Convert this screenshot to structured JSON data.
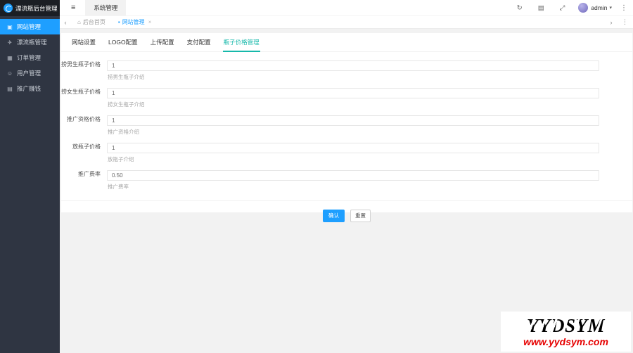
{
  "app": {
    "title": "漂流瓶后台管理"
  },
  "header": {
    "icons": {
      "hamburger": "≡",
      "refresh": "↻",
      "messages": "▤",
      "fullscreen": "⤢",
      "caret": "▾",
      "more": "⋮"
    },
    "nav": [
      {
        "label": "系统管理"
      }
    ],
    "user": "admin"
  },
  "tabbar": {
    "prev": "‹",
    "next": "›",
    "more": "⋮",
    "tabs": [
      {
        "icon": "⌂",
        "label": "后台首页"
      },
      {
        "icon": "▪",
        "label": "网站管理",
        "close": "×"
      }
    ]
  },
  "sidebar": {
    "items": [
      {
        "icon": "▣",
        "label": "网站管理"
      },
      {
        "icon": "✈",
        "label": "漂流瓶管理"
      },
      {
        "icon": "▦",
        "label": "订单管理"
      },
      {
        "icon": "☺",
        "label": "用户管理"
      },
      {
        "icon": "▤",
        "label": "推广赚钱"
      }
    ]
  },
  "main": {
    "tabs": [
      {
        "label": "网站设置"
      },
      {
        "label": "LOGO配置"
      },
      {
        "label": "上传配置"
      },
      {
        "label": "支付配置"
      },
      {
        "label": "瓶子价格管理"
      }
    ],
    "form": {
      "fields": [
        {
          "label": "捞男生瓶子价格",
          "value": "1",
          "help": "捞男生瓶子介绍"
        },
        {
          "label": "捞女生瓶子价格",
          "value": "1",
          "help": "捞女生瓶子介绍"
        },
        {
          "label": "推广资格价格",
          "value": "1",
          "help": "推广资格介绍"
        },
        {
          "label": "放瓶子价格",
          "value": "1",
          "help": "放瓶子介绍"
        },
        {
          "label": "推广费率",
          "value": "0.50",
          "help": "推广费率"
        }
      ],
      "buttons": {
        "confirm": "确认",
        "reset": "重置"
      }
    }
  },
  "watermark": {
    "title": "YYDSYM",
    "url": "www.yydsym.com"
  },
  "colors": {
    "accent": "#1E9FFF",
    "content_tab_active": "#16b8aa",
    "sidebar_bg": "#2f3542",
    "logo_bg": "#1b1e24",
    "watermark_red": "#e60000"
  }
}
